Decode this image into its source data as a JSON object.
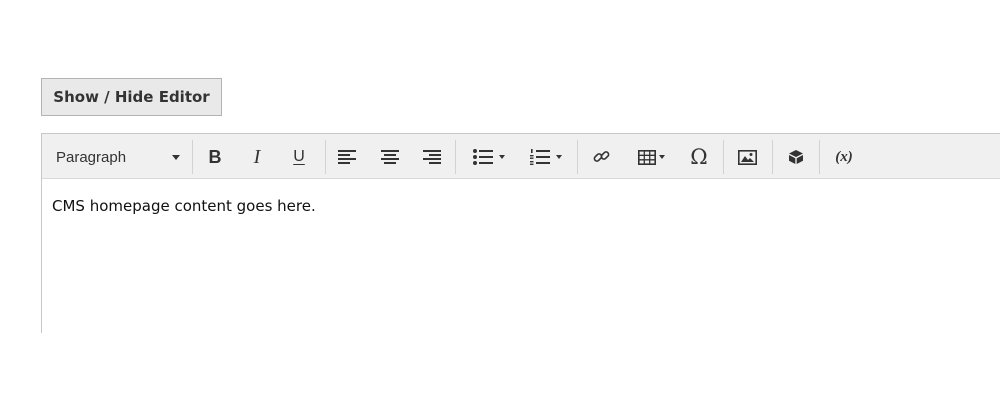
{
  "toggle": {
    "label": "Show / Hide Editor"
  },
  "toolbar": {
    "format_value": "Paragraph",
    "bold_glyph": "B",
    "italic_glyph": "I",
    "underline_glyph": "U",
    "special_char_glyph": "Ω",
    "variable_glyph": "(x)",
    "icons": [
      "caret-down-icon",
      "bold-icon",
      "italic-icon",
      "underline-icon",
      "align-left-icon",
      "align-center-icon",
      "align-right-icon",
      "bullet-list-icon",
      "numbered-list-icon",
      "link-icon",
      "table-icon",
      "omega-icon",
      "image-icon",
      "embed-icon",
      "variable-icon"
    ]
  },
  "editor": {
    "content": "CMS homepage content goes here."
  }
}
